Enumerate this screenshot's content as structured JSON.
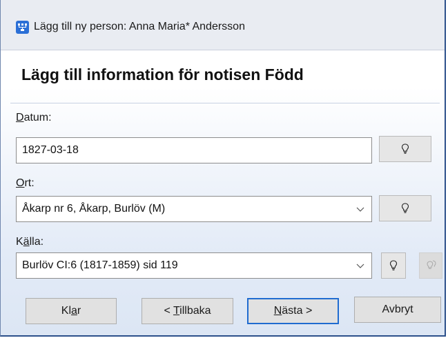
{
  "window": {
    "title": "Lägg till ny person: Anna Maria* Andersson",
    "heading": "Lägg till information för notisen Född"
  },
  "fields": {
    "date": {
      "label_mnemonic": "D",
      "label_rest": "atum:",
      "value": "1827-03-18"
    },
    "place": {
      "label_mnemonic": "O",
      "label_rest": "rt:",
      "value": "Åkarp nr 6, Åkarp, Burlöv (M)"
    },
    "source": {
      "label_pre": "K",
      "label_mnemonic": "ä",
      "label_rest": "lla:",
      "value": "Burlöv CI:6 (1817-1859) sid 119"
    }
  },
  "buttons": {
    "finish": {
      "pre": "Kl",
      "mnemonic": "a",
      "post": "r"
    },
    "back": {
      "pre": "< ",
      "mnemonic": "T",
      "post": "illbaka"
    },
    "next": {
      "pre": "",
      "mnemonic": "N",
      "post": "ästa >"
    },
    "cancel": {
      "pre": "Avbryt",
      "mnemonic": "",
      "post": ""
    }
  },
  "icons": {
    "app": "family-tree-icon",
    "hint": "lightbulb-icon",
    "hint_disabled": "lightbulb-double-icon",
    "dropdown": "chevron-down-icon"
  },
  "colors": {
    "accent": "#1f6bd0",
    "app_icon": "#2b6fd6"
  }
}
